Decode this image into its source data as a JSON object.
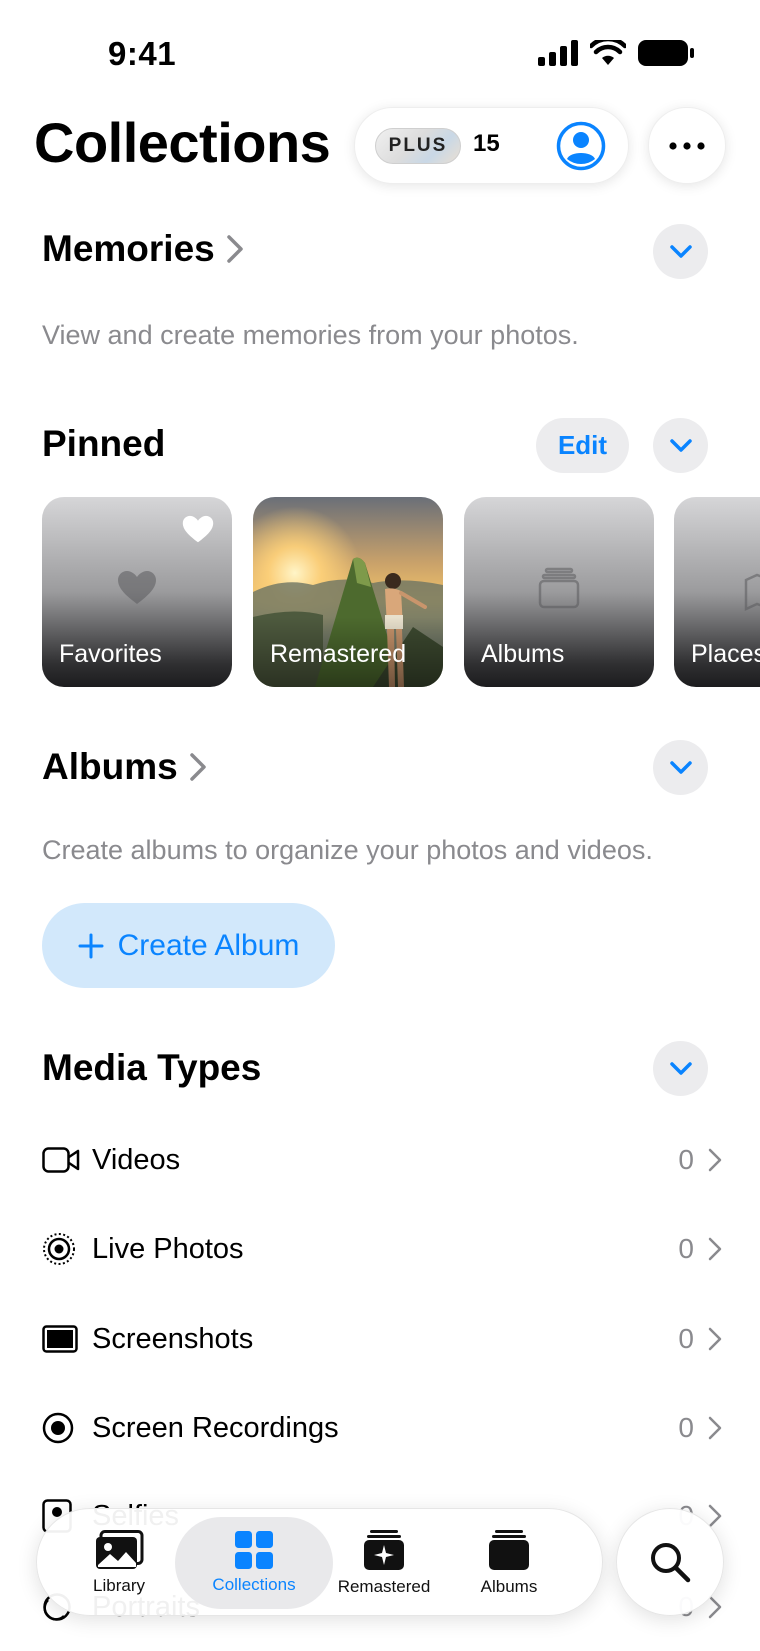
{
  "status_bar": {
    "time": "9:41"
  },
  "header": {
    "title": "Collections",
    "plus_badge": "PLUS",
    "plus_count": "15"
  },
  "memories": {
    "title": "Memories",
    "description": "View and create memories from your photos."
  },
  "pinned": {
    "title": "Pinned",
    "edit_label": "Edit",
    "cards": [
      {
        "label": "Favorites",
        "icon": "heart-icon"
      },
      {
        "label": "Remastered",
        "icon": "photo"
      },
      {
        "label": "Albums",
        "icon": "albums-stack-icon"
      },
      {
        "label": "Places",
        "icon": "map-icon"
      }
    ]
  },
  "albums": {
    "title": "Albums",
    "description": "Create albums to organize your photos and videos.",
    "create_label": "Create Album"
  },
  "media_types": {
    "title": "Media Types",
    "items": [
      {
        "label": "Videos",
        "count": "0",
        "icon": "video-camera-icon"
      },
      {
        "label": "Live Photos",
        "count": "0",
        "icon": "live-photo-icon"
      },
      {
        "label": "Screenshots",
        "count": "0",
        "icon": "screenshot-icon"
      },
      {
        "label": "Screen Recordings",
        "count": "0",
        "icon": "screen-recording-icon"
      },
      {
        "label": "Selfies",
        "count": "0",
        "icon": "selfie-icon"
      },
      {
        "label": "Portraits",
        "count": "0",
        "icon": "portrait-icon"
      }
    ]
  },
  "tab_bar": {
    "tabs": [
      {
        "label": "Library",
        "icon": "library-icon"
      },
      {
        "label": "Collections",
        "icon": "collections-grid-icon",
        "active": true
      },
      {
        "label": "Remastered",
        "icon": "remastered-icon"
      },
      {
        "label": "Albums",
        "icon": "albums-icon"
      }
    ],
    "search_icon": "search-icon"
  },
  "colors": {
    "accent": "#0a84ff",
    "secondary_text": "#8a8a8e",
    "chip_bg": "#ececee",
    "create_album_bg": "#d2e8fb"
  }
}
